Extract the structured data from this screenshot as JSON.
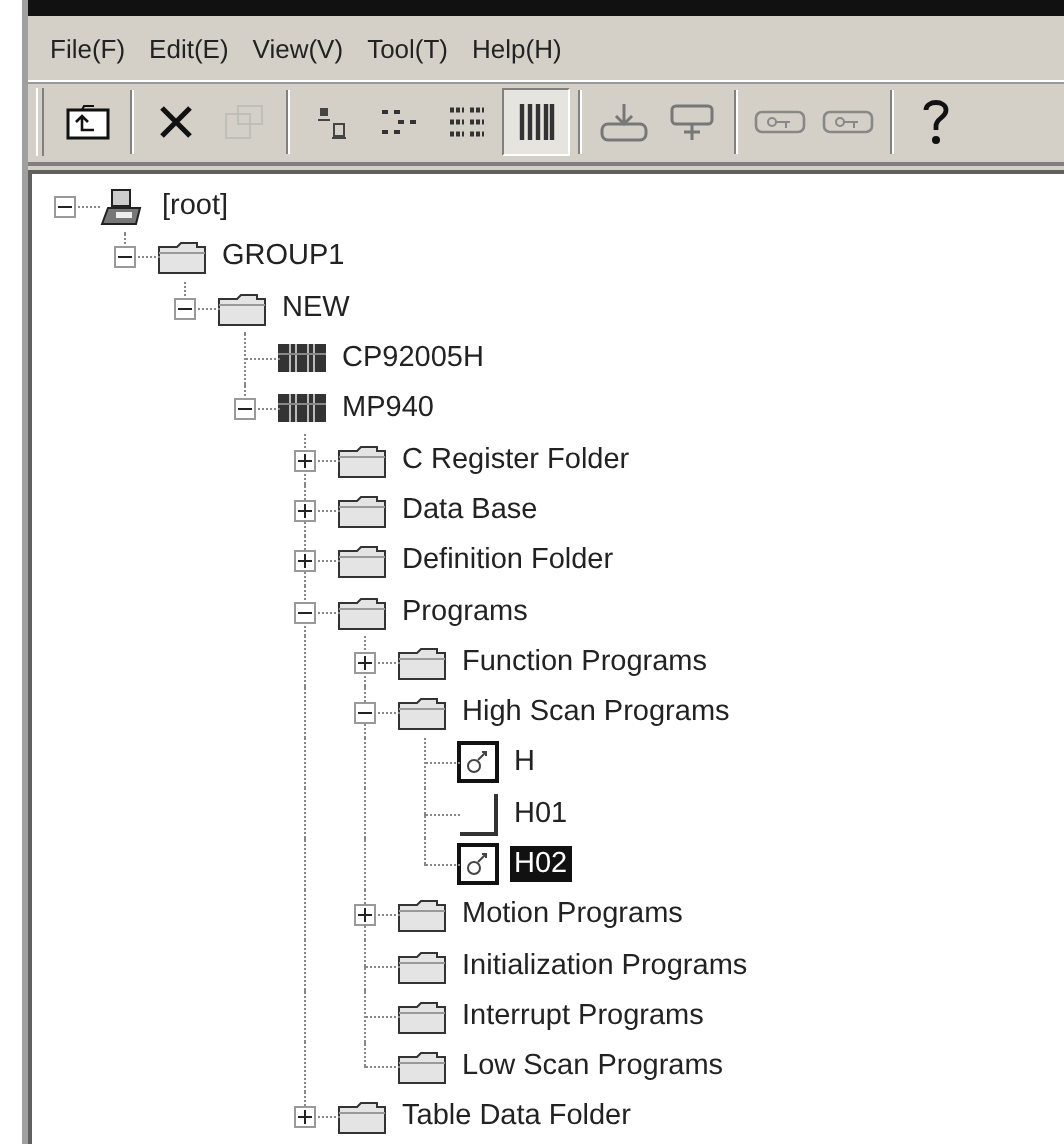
{
  "menu": [
    "File(F)",
    "Edit(E)",
    "View(V)",
    "Tool(T)",
    "Help(H)"
  ],
  "toolbar": [
    [
      {
        "kind": "up-folder",
        "disabled": false,
        "pressed": false
      }
    ],
    [
      {
        "kind": "delete",
        "disabled": false,
        "pressed": false
      },
      {
        "kind": "properties",
        "disabled": true,
        "pressed": false
      }
    ],
    [
      {
        "kind": "large-icons",
        "disabled": false,
        "pressed": false
      },
      {
        "kind": "small-icons",
        "disabled": false,
        "pressed": false
      },
      {
        "kind": "list",
        "disabled": false,
        "pressed": false
      },
      {
        "kind": "details",
        "disabled": false,
        "pressed": true
      }
    ],
    [
      {
        "kind": "import",
        "disabled": false,
        "pressed": false
      },
      {
        "kind": "export",
        "disabled": false,
        "pressed": false
      }
    ],
    [
      {
        "kind": "key",
        "disabled": false,
        "pressed": false
      },
      {
        "kind": "key",
        "disabled": false,
        "pressed": false
      }
    ],
    [
      {
        "kind": "help",
        "disabled": false,
        "pressed": false
      }
    ]
  ],
  "tree": [
    {
      "label": "[root]",
      "kind": "root",
      "expanded": true,
      "selected": false,
      "children": [
        {
          "label": "GROUP1",
          "kind": "folder",
          "expanded": true,
          "selected": false,
          "children": [
            {
              "label": "NEW",
              "kind": "folder",
              "expanded": true,
              "selected": false,
              "children": [
                {
                  "label": "CP92005H",
                  "kind": "module",
                  "selected": false
                },
                {
                  "label": "MP940",
                  "kind": "module",
                  "expanded": true,
                  "selected": false,
                  "children": [
                    {
                      "label": "C Register Folder",
                      "kind": "folder",
                      "expanded": false,
                      "selected": false
                    },
                    {
                      "label": "Data Base",
                      "kind": "folder",
                      "expanded": false,
                      "selected": false
                    },
                    {
                      "label": "Definition Folder",
                      "kind": "folder",
                      "expanded": false,
                      "selected": false
                    },
                    {
                      "label": "Programs",
                      "kind": "folder",
                      "expanded": true,
                      "selected": false,
                      "children": [
                        {
                          "label": "Function Programs",
                          "kind": "folder",
                          "expanded": false,
                          "selected": false
                        },
                        {
                          "label": "High Scan Programs",
                          "kind": "folder",
                          "expanded": true,
                          "selected": false,
                          "children": [
                            {
                              "label": "H",
                              "kind": "program",
                              "selected": false
                            },
                            {
                              "label": "H01",
                              "kind": "blank",
                              "selected": false
                            },
                            {
                              "label": "H02",
                              "kind": "program",
                              "selected": true
                            }
                          ]
                        },
                        {
                          "label": "Motion Programs",
                          "kind": "folder",
                          "expanded": false,
                          "selected": false
                        },
                        {
                          "label": "Initialization Programs",
                          "kind": "folder",
                          "selected": false
                        },
                        {
                          "label": "Interrupt Programs",
                          "kind": "folder",
                          "selected": false
                        },
                        {
                          "label": "Low Scan Programs",
                          "kind": "folder",
                          "selected": false
                        }
                      ]
                    },
                    {
                      "label": "Table Data Folder",
                      "kind": "folder",
                      "expanded": false,
                      "selected": false
                    }
                  ]
                }
              ]
            }
          ]
        }
      ]
    }
  ]
}
